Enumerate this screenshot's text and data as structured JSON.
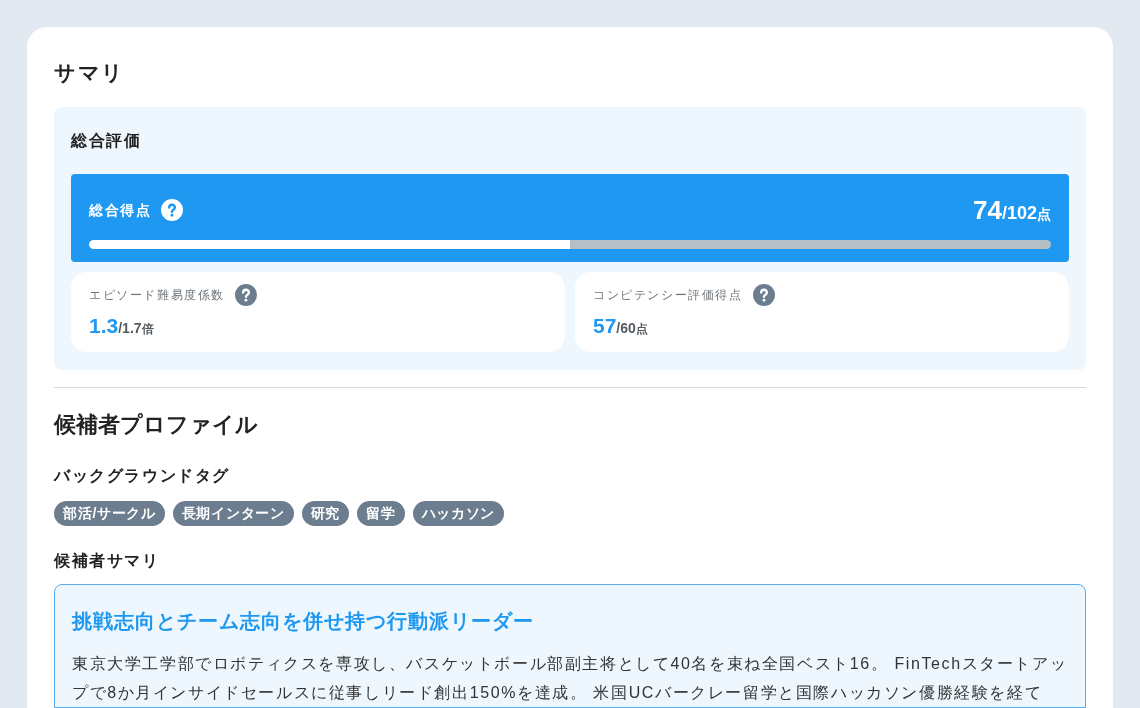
{
  "summary": {
    "title": "サマリ",
    "overall": {
      "heading": "総合評価",
      "total": {
        "label": "総合得点",
        "score": "74",
        "max": "/102",
        "unit": "点",
        "level": 0.5
      },
      "metrics": [
        {
          "label": "エピソード難易度係数",
          "value": "1.3",
          "max": "/1.7",
          "unit": "倍"
        },
        {
          "label": "コンピテンシー評価得点",
          "value": "57",
          "max": "/60",
          "unit": "点"
        }
      ]
    }
  },
  "profile": {
    "title": "候補者プロファイル",
    "tags_heading": "バックグラウンドタグ",
    "tags": [
      "部活/サークル",
      "長期インターン",
      "研究",
      "留学",
      "ハッカソン"
    ],
    "summary_heading": "候補者サマリ",
    "summary_card": {
      "headline": "挑戦志向とチーム志向を併せ持つ行動派リーダー",
      "body": "東京大学工学部でロボティクスを専攻し、バスケットボール部副主将として40名を束ね全国ベスト16。 FinTechスタートアップで8か月インサイドセールスに従事しリード創出150%を達成。 米国UCバークレー留学と国際ハッカソン優勝経験を経て"
    }
  }
}
